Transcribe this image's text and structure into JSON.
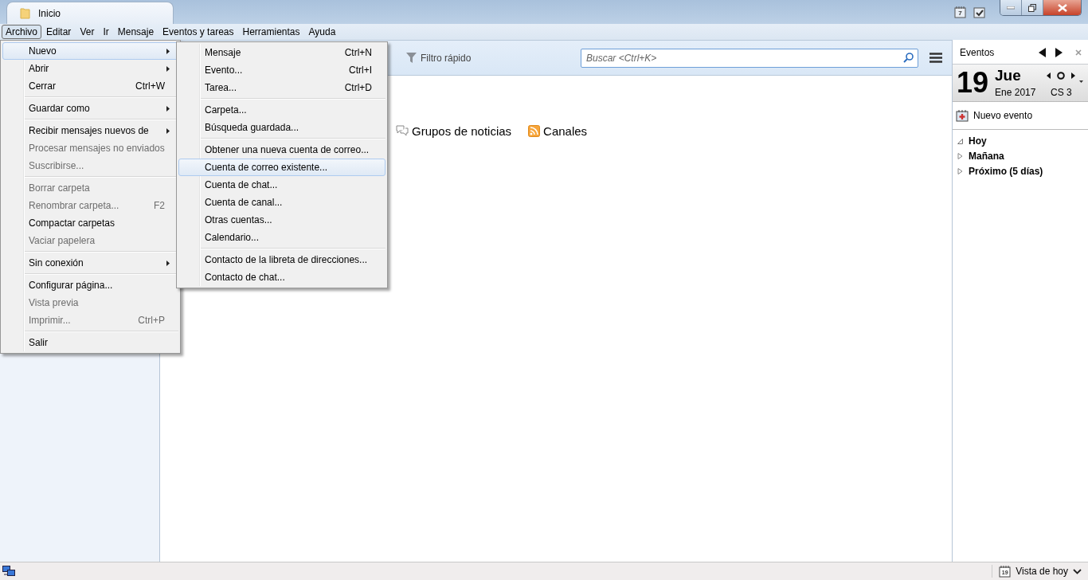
{
  "window": {
    "tab": {
      "title": "Inicio"
    },
    "calendar_icon_day": "7"
  },
  "menubar": [
    {
      "label": "Archivo",
      "selected": true
    },
    {
      "label": "Editar",
      "selected": false
    },
    {
      "label": "Ver",
      "selected": false
    },
    {
      "label": "Ir",
      "selected": false
    },
    {
      "label": "Mensaje",
      "selected": false
    },
    {
      "label": "Eventos y tareas",
      "selected": false
    },
    {
      "label": "Herramientas",
      "selected": false
    },
    {
      "label": "Ayuda",
      "selected": false
    }
  ],
  "file_menu": [
    {
      "kind": "item",
      "label": "Nuevo",
      "submenu": true,
      "disabled": false,
      "selected": true
    },
    {
      "kind": "item",
      "label": "Abrir",
      "submenu": true,
      "disabled": false,
      "selected": false
    },
    {
      "kind": "item",
      "label": "Cerrar",
      "shortcut": "Ctrl+W",
      "submenu": false,
      "disabled": false,
      "selected": false
    },
    {
      "kind": "separator"
    },
    {
      "kind": "item",
      "label": "Guardar como",
      "submenu": true,
      "disabled": false,
      "selected": false
    },
    {
      "kind": "separator"
    },
    {
      "kind": "item",
      "label": "Recibir mensajes nuevos de",
      "submenu": true,
      "disabled": false,
      "selected": false
    },
    {
      "kind": "item",
      "label": "Procesar mensajes no enviados",
      "submenu": false,
      "disabled": true,
      "selected": false
    },
    {
      "kind": "item",
      "label": "Suscribirse...",
      "submenu": false,
      "disabled": true,
      "selected": false
    },
    {
      "kind": "separator"
    },
    {
      "kind": "item",
      "label": "Borrar carpeta",
      "submenu": false,
      "disabled": true,
      "selected": false
    },
    {
      "kind": "item",
      "label": "Renombrar carpeta...",
      "shortcut": "F2",
      "submenu": false,
      "disabled": true,
      "selected": false
    },
    {
      "kind": "item",
      "label": "Compactar carpetas",
      "submenu": false,
      "disabled": false,
      "selected": false
    },
    {
      "kind": "item",
      "label": "Vaciar papelera",
      "submenu": false,
      "disabled": true,
      "selected": false
    },
    {
      "kind": "separator"
    },
    {
      "kind": "item",
      "label": "Sin conexión",
      "submenu": true,
      "disabled": false,
      "selected": false
    },
    {
      "kind": "separator"
    },
    {
      "kind": "item",
      "label": "Configurar página...",
      "submenu": false,
      "disabled": false,
      "selected": false
    },
    {
      "kind": "item",
      "label": "Vista previa",
      "submenu": false,
      "disabled": true,
      "selected": false
    },
    {
      "kind": "item",
      "label": "Imprimir...",
      "shortcut": "Ctrl+P",
      "submenu": false,
      "disabled": true,
      "selected": false
    },
    {
      "kind": "separator"
    },
    {
      "kind": "item",
      "label": "Salir",
      "submenu": false,
      "disabled": false,
      "selected": false
    }
  ],
  "new_submenu": [
    {
      "kind": "item",
      "label": "Mensaje",
      "shortcut": "Ctrl+N",
      "disabled": false,
      "selected": false
    },
    {
      "kind": "item",
      "label": "Evento...",
      "shortcut": "Ctrl+I",
      "disabled": false,
      "selected": false
    },
    {
      "kind": "item",
      "label": "Tarea...",
      "shortcut": "Ctrl+D",
      "disabled": false,
      "selected": false
    },
    {
      "kind": "separator"
    },
    {
      "kind": "item",
      "label": "Carpeta...",
      "disabled": false,
      "selected": false
    },
    {
      "kind": "item",
      "label": "Búsqueda guardada...",
      "disabled": false,
      "selected": false
    },
    {
      "kind": "separator"
    },
    {
      "kind": "item",
      "label": "Obtener una nueva cuenta de correo...",
      "disabled": false,
      "selected": false
    },
    {
      "kind": "item",
      "label": "Cuenta de correo existente...",
      "disabled": false,
      "selected": true
    },
    {
      "kind": "item",
      "label": "Cuenta de chat...",
      "disabled": false,
      "selected": false
    },
    {
      "kind": "item",
      "label": "Cuenta de canal...",
      "disabled": false,
      "selected": false
    },
    {
      "kind": "item",
      "label": "Otras cuentas...",
      "disabled": false,
      "selected": false
    },
    {
      "kind": "item",
      "label": "Calendario...",
      "disabled": false,
      "selected": false
    },
    {
      "kind": "separator"
    },
    {
      "kind": "item",
      "label": "Contacto de la libreta de direcciones...",
      "disabled": false,
      "selected": false
    },
    {
      "kind": "item",
      "label": "Contacto de chat...",
      "disabled": false,
      "selected": false
    }
  ],
  "toolbar": {
    "quick_filter": "Filtro rápido",
    "search": {
      "placeholder": "Buscar <Ctrl+K>"
    }
  },
  "content": {
    "links": [
      {
        "kind": "newsgroups",
        "label": "Grupos de noticias"
      },
      {
        "kind": "feeds",
        "label": "Canales"
      }
    ]
  },
  "events_pane": {
    "title": "Eventos",
    "day_number": "19",
    "weekday": "Jue",
    "month_year": "Ene 2017",
    "week": "CS 3",
    "new_event": "Nuevo evento",
    "groups": [
      {
        "label": "Hoy",
        "expanded": true
      },
      {
        "label": "Mañana",
        "expanded": false
      },
      {
        "label": "Próximo (5 días)",
        "expanded": false
      }
    ]
  },
  "status_bar": {
    "today_icon_day": "19",
    "today_pane": "Vista de hoy"
  }
}
